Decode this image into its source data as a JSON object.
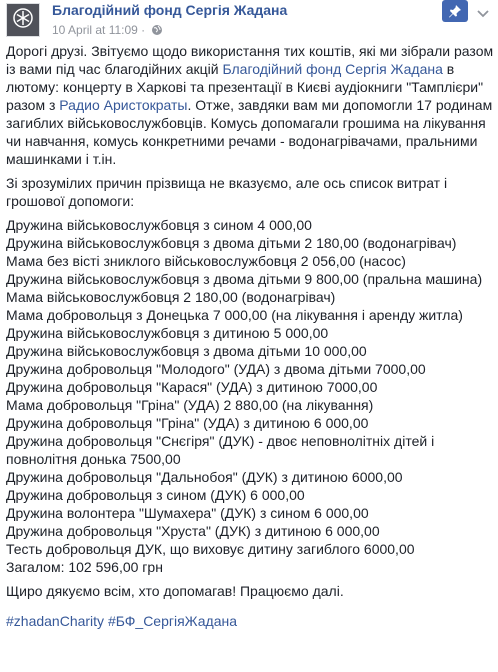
{
  "post": {
    "page_name": "Благодійний фонд Сергія Жадана",
    "timestamp": "10 April at 11:09",
    "separator": " · ",
    "icons": {
      "avatar": "charity-fund-logo-icon",
      "privacy": "globe-icon",
      "pin": "pin-icon",
      "menu": "chevron-down-icon"
    },
    "intro": {
      "t1": "Дорогі друзі. Звітуємо щодо використання тих коштів, які ми зібрали разом із вами під час благодійних акцій ",
      "link1": "Благодійний фонд Сергія Жадана",
      "t2": " в лютому: концерту в Харкові та презентації в Києві аудіокниги \"Тамплієри\" разом з ",
      "link2": "Радио Аристократы",
      "t3": ". Отже, завдяки вам ми допомогли 17 родинам загиблих військовослужбовців. Комусь допомагали грошима на лікування чи навчання, комусь конкретними речами - водонагрівачами, пральними машинками і т.ін."
    },
    "list_intro": "Зі зрозумілих причин прізвища не вказуємо, але ось список витрат і грошової допомоги:",
    "items": [
      "Дружина військовослужбовця з сином 4 000,00",
      "Дружина військовослужбовця з двома дітьми 2 180,00 (водонагрівач)",
      "Мама без вісті зниклого військовослужбовця 2 056,00 (насос)",
      "Дружина військовослужбовця з двома дітьми 9 800,00 (пральна машина)",
      "Мама військовослужбовця 2 180,00 (водонагрівач)",
      "Мама добровольця з Донецька 7 000,00 (на лікування і аренду житла)",
      "Дружина військовослужбовця з дитиною 5 000,00",
      "Дружина військовослужбовця з двома дітьми 10 000,00",
      "Дружина добровольця \"Молодого\" (УДА) з двома дітьми 7000,00",
      "Дружина добровольця \"Карася\" (УДА) з дитиною 7000,00",
      "Мама добровольця \"Гріна\" (УДА) 2 880,00 (на лікування)",
      "Дружина добровольця \"Гріна\" (УДА) з дитиною 6 000,00",
      "Дружина добровольця \"Снєгіря\" (ДУК) - двоє неповнолітніх дітей і повнолітня донька 7500,00",
      "Дружина добровольця \"Дальнобоя\" (ДУК) з дитиною 6000,00",
      "Дружина добровольця з сином (ДУК) 6 000,00",
      "Дружина волонтера \"Шумахера\" (ДУК) з сином 6 000,00",
      "Дружина добровольця \"Хруста\" (ДУК) з дитиною 6 000,00",
      "Тесть добровольця ДУК, що виховує дитину загиблого 6000,00",
      "Загалом: 102 596,00 грн"
    ],
    "thanks": "Щиро дякуємо всім, хто допомагав! Працюємо далі.",
    "hashtags": "#zhadanCharity #БФ_СергіяЖадана"
  }
}
